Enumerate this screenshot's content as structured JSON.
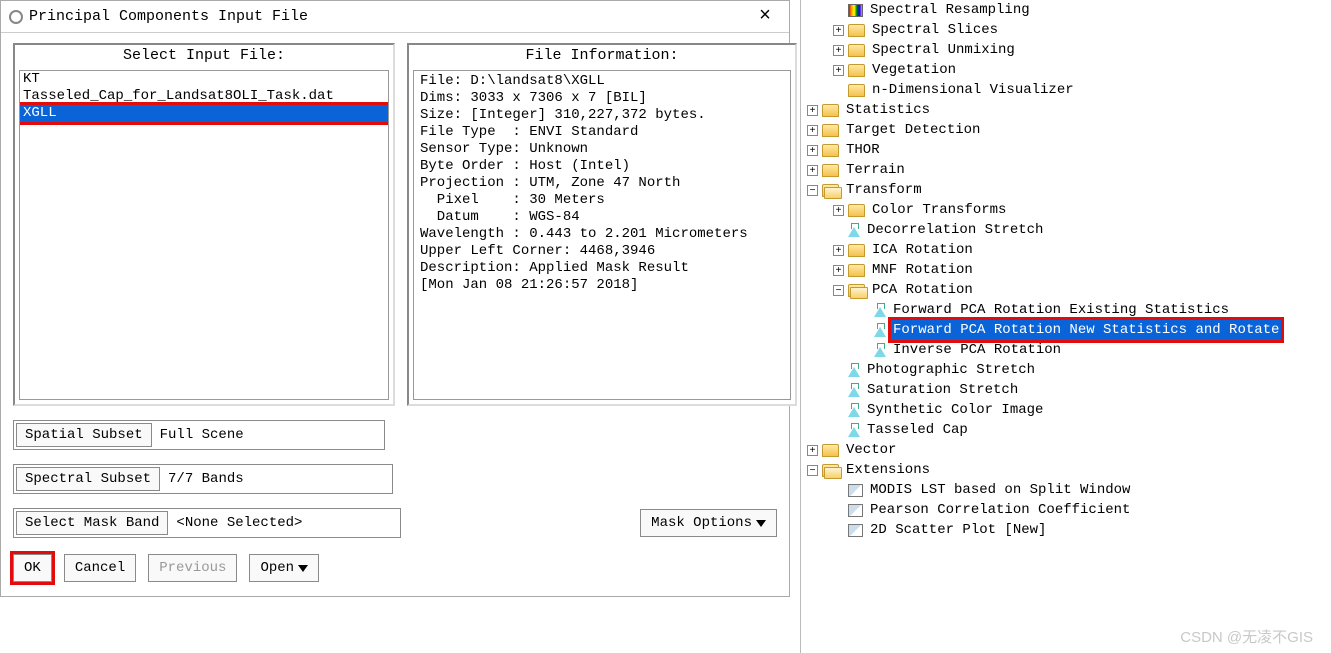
{
  "dialog": {
    "title": "Principal Components Input File",
    "input_panel_title": "Select Input File:",
    "info_panel_title": "File Information:",
    "files": [
      "KT",
      "Tasseled_Cap_for_Landsat8OLI_Task.dat",
      "XGLL"
    ],
    "selected_file": "XGLL",
    "info_text": "File: D:\\landsat8\\XGLL\nDims: 3033 x 7306 x 7 [BIL]\nSize: [Integer] 310,227,372 bytes.\nFile Type  : ENVI Standard\nSensor Type: Unknown\nByte Order : Host (Intel)\nProjection : UTM, Zone 47 North\n  Pixel    : 30 Meters\n  Datum    : WGS-84\nWavelength : 0.443 to 2.201 Micrometers\nUpper Left Corner: 4468,3946\nDescription: Applied Mask Result\n[Mon Jan 08 21:26:57 2018]",
    "spatial_btn": "Spatial Subset",
    "spatial_val": "Full Scene",
    "spectral_btn": "Spectral Subset",
    "spectral_val": "7/7 Bands",
    "mask_btn": "Select Mask Band",
    "mask_val": "<None Selected>",
    "mask_opts": "Mask Options",
    "ok": "OK",
    "cancel": "Cancel",
    "previous": "Previous",
    "open": "Open"
  },
  "tree": [
    {
      "d": 1,
      "t": "folder",
      "exp": "",
      "lbl": "Spectral Resampling",
      "icon": "rainbow"
    },
    {
      "d": 1,
      "t": "folder",
      "exp": "+",
      "lbl": "Spectral Slices"
    },
    {
      "d": 1,
      "t": "folder",
      "exp": "+",
      "lbl": "Spectral Unmixing"
    },
    {
      "d": 1,
      "t": "folder",
      "exp": "+",
      "lbl": "Vegetation"
    },
    {
      "d": 1,
      "t": "folder",
      "exp": "",
      "lbl": "n-Dimensional Visualizer"
    },
    {
      "d": 0,
      "t": "folder",
      "exp": "+",
      "lbl": "Statistics"
    },
    {
      "d": 0,
      "t": "folder",
      "exp": "+",
      "lbl": "Target Detection"
    },
    {
      "d": 0,
      "t": "folder",
      "exp": "+",
      "lbl": "THOR"
    },
    {
      "d": 0,
      "t": "folder",
      "exp": "+",
      "lbl": "Terrain"
    },
    {
      "d": 0,
      "t": "folder",
      "exp": "-",
      "lbl": "Transform",
      "open": true
    },
    {
      "d": 1,
      "t": "folder",
      "exp": "+",
      "lbl": "Color Transforms"
    },
    {
      "d": 1,
      "t": "flask",
      "exp": "",
      "lbl": "Decorrelation Stretch"
    },
    {
      "d": 1,
      "t": "folder",
      "exp": "+",
      "lbl": "ICA Rotation"
    },
    {
      "d": 1,
      "t": "folder",
      "exp": "+",
      "lbl": "MNF Rotation"
    },
    {
      "d": 1,
      "t": "folder",
      "exp": "-",
      "lbl": "PCA Rotation",
      "open": true
    },
    {
      "d": 2,
      "t": "flask",
      "exp": "",
      "lbl": "Forward PCA Rotation Existing Statistics"
    },
    {
      "d": 2,
      "t": "flask",
      "exp": "",
      "lbl": "Forward PCA Rotation New Statistics and Rotate",
      "sel": true,
      "red": true
    },
    {
      "d": 2,
      "t": "flask",
      "exp": "",
      "lbl": "Inverse PCA Rotation"
    },
    {
      "d": 1,
      "t": "flask",
      "exp": "",
      "lbl": "Photographic Stretch"
    },
    {
      "d": 1,
      "t": "flask",
      "exp": "",
      "lbl": "Saturation Stretch"
    },
    {
      "d": 1,
      "t": "flask",
      "exp": "",
      "lbl": "Synthetic Color Image"
    },
    {
      "d": 1,
      "t": "flask",
      "exp": "",
      "lbl": "Tasseled Cap"
    },
    {
      "d": 0,
      "t": "folder",
      "exp": "+",
      "lbl": "Vector"
    },
    {
      "d": 0,
      "t": "folder",
      "exp": "-",
      "lbl": "Extensions",
      "open": true
    },
    {
      "d": 1,
      "t": "img",
      "exp": "",
      "lbl": "MODIS LST based on Split Window"
    },
    {
      "d": 1,
      "t": "img",
      "exp": "",
      "lbl": "Pearson Correlation Coefficient"
    },
    {
      "d": 1,
      "t": "img",
      "exp": "",
      "lbl": "2D Scatter Plot [New]"
    }
  ],
  "watermark": "CSDN @无凌不GIS"
}
